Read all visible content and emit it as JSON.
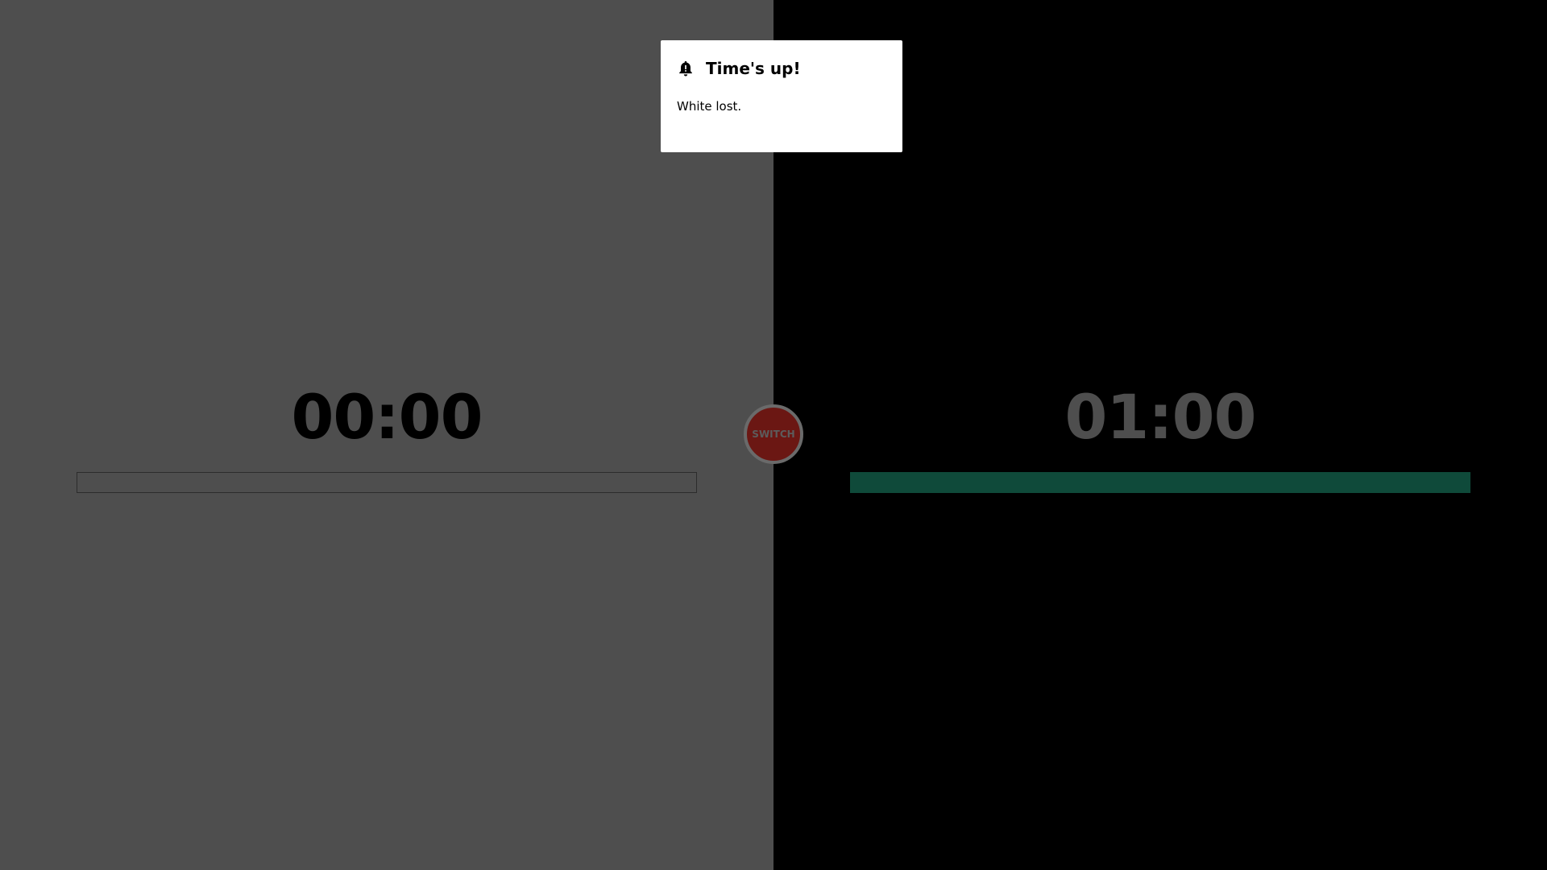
{
  "players": {
    "white": {
      "time": "00:00",
      "progress_fraction": 0.0,
      "bg_color": "#4e4e4e",
      "bar_color": "#2c2c2c"
    },
    "black": {
      "time": "01:00",
      "progress_fraction": 1.0,
      "bg_color": "#000000",
      "bar_color": "#0f4a3a"
    }
  },
  "switch_button": {
    "label": "SWITCH",
    "color": "#6b1713"
  },
  "dialog": {
    "icon": "bell-alert-icon",
    "title": "Time's up!",
    "message": "White lost."
  }
}
